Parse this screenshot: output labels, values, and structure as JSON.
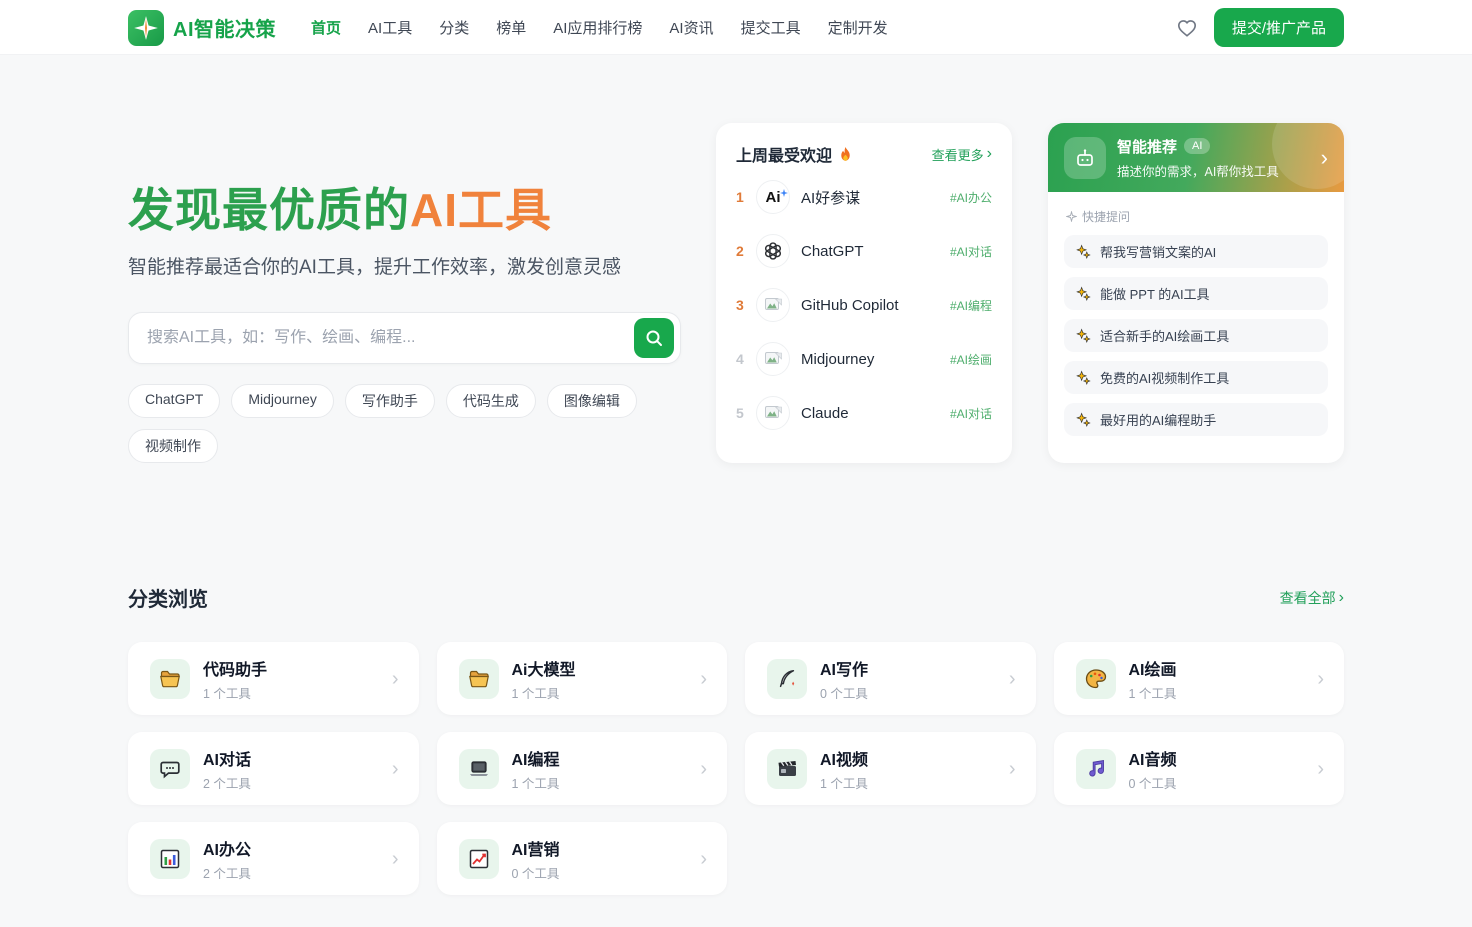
{
  "icons": {
    "chevron": "›"
  },
  "colors": {
    "brand_green": "#18a84c",
    "title_green": "#2ca04e",
    "accent_orange": "#f0823c",
    "tag_green": "#4fae6d"
  },
  "header": {
    "brand": "AI智能决策",
    "nav": [
      "首页",
      "AI工具",
      "分类",
      "榜单",
      "AI应用排行榜",
      "AI资讯",
      "提交工具",
      "定制开发"
    ],
    "submit_button": "提交/推广产品"
  },
  "hero": {
    "title_green": "发现最优质的",
    "title_orange": "AI工具",
    "subtitle": "智能推荐最适合你的AI工具，提升工作效率，激发创意灵感",
    "search_placeholder": "搜索AI工具，如：写作、绘画、编程...",
    "tags": [
      "ChatGPT",
      "Midjourney",
      "写作助手",
      "代码生成",
      "图像编辑",
      "视频制作"
    ]
  },
  "popular": {
    "title": "上周最受欢迎",
    "more_link": "查看更多",
    "items": [
      {
        "rank": "1",
        "name": "AI好参谋",
        "tag": "#AI办公",
        "logo": "ai-haocanmou"
      },
      {
        "rank": "2",
        "name": "ChatGPT",
        "tag": "#AI对话",
        "logo": "openai"
      },
      {
        "rank": "3",
        "name": "GitHub Copilot",
        "tag": "#AI编程",
        "logo": "broken-image"
      },
      {
        "rank": "4",
        "name": "Midjourney",
        "tag": "#AI绘画",
        "logo": "broken-image"
      },
      {
        "rank": "5",
        "name": "Claude",
        "tag": "#AI对话",
        "logo": "broken-image"
      }
    ]
  },
  "smart": {
    "title": "智能推荐",
    "badge": "AI",
    "subtitle": "描述你的需求，AI帮你找工具",
    "quick_label": "快捷提问",
    "questions": [
      "帮我写营销文案的AI",
      "能做 PPT 的AI工具",
      "适合新手的AI绘画工具",
      "免费的AI视频制作工具",
      "最好用的AI编程助手"
    ]
  },
  "categories": {
    "title": "分类浏览",
    "view_all": "查看全部",
    "items": [
      {
        "name": "代码助手",
        "count": "1 个工具",
        "icon": "folder-icon"
      },
      {
        "name": "Ai大模型",
        "count": "1 个工具",
        "icon": "folder-icon"
      },
      {
        "name": "AI写作",
        "count": "0 个工具",
        "icon": "quill-icon"
      },
      {
        "name": "AI绘画",
        "count": "1 个工具",
        "icon": "palette-icon"
      },
      {
        "name": "AI对话",
        "count": "2 个工具",
        "icon": "chat-bubble-icon"
      },
      {
        "name": "AI编程",
        "count": "1 个工具",
        "icon": "laptop-icon"
      },
      {
        "name": "AI视频",
        "count": "1 个工具",
        "icon": "clapperboard-icon"
      },
      {
        "name": "AI音频",
        "count": "0 个工具",
        "icon": "music-note-icon"
      },
      {
        "name": "AI办公",
        "count": "2 个工具",
        "icon": "bar-chart-icon"
      },
      {
        "name": "AI营销",
        "count": "0 个工具",
        "icon": "trend-chart-icon"
      }
    ]
  }
}
